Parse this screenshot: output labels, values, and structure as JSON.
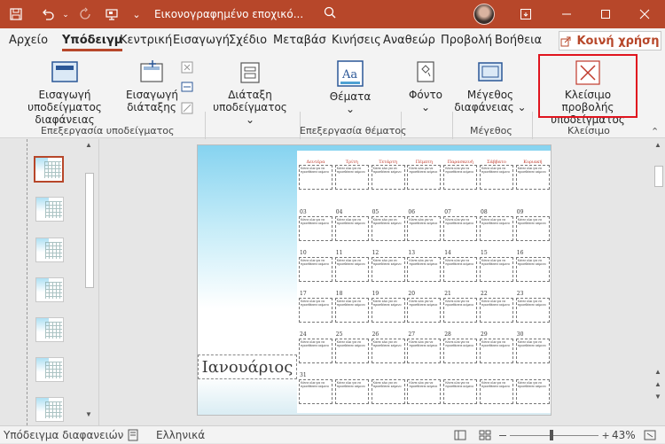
{
  "titlebar": {
    "title": "Εικονογραφημένο εποχικό...",
    "icons": [
      "save-icon",
      "undo-icon",
      "redo-icon",
      "present-icon",
      "more-icon",
      "search-icon"
    ]
  },
  "tabs": [
    "Αρχείο",
    "Υπόδειγμ",
    "Κεντρική",
    "Εισαγωγή",
    "Σχέδιο",
    "Μεταβάσ",
    "Κινήσεις",
    "Αναθεώρ",
    "Προβολή",
    "Βοήθεια"
  ],
  "share": {
    "label": "Κοινή χρήση"
  },
  "ribbon": {
    "insert_slide_master": "Εισαγωγή υποδείγματος διαφάνειας",
    "insert_layout": "Εισαγωγή διάταξης",
    "master_layout": "Διάταξη υποδείγματος",
    "themes": "Θέματα",
    "fonts": "Φόντο",
    "slide_size": "Μέγεθος διαφάνειας",
    "close_master": "Κλείσιμο προβολής υποδείγματος",
    "groups": {
      "edit_master": "Επεξεργασία υποδείγματος",
      "edit_theme": "Επεξεργασία θέματος",
      "size": "Μέγεθος",
      "close": "Κλείσιμο"
    }
  },
  "slide": {
    "days": [
      "Δευτέρα",
      "Τρίτη",
      "Τετάρτη",
      "Πέμπτη",
      "Παρασκευή",
      "Σάββατο",
      "Κυριακή"
    ],
    "rows": [
      [
        "",
        "",
        "",
        "",
        "",
        "",
        ""
      ],
      [
        "03",
        "04",
        "05",
        "06",
        "07",
        "08",
        "09"
      ],
      [
        "10",
        "11",
        "12",
        "13",
        "14",
        "15",
        "16"
      ],
      [
        "17",
        "18",
        "19",
        "20",
        "21",
        "22",
        "23"
      ],
      [
        "24",
        "25",
        "26",
        "27",
        "28",
        "29",
        "30"
      ],
      [
        "31",
        "",
        "",
        "",
        "",
        "",
        ""
      ]
    ],
    "placeholder": "Κάντε κλικ για να προσθέσετε κείμενο",
    "month": "Ιανουάριος"
  },
  "status": {
    "view": "Υπόδειγμα διαφανειών",
    "language": "Ελληνικά",
    "zoom": "43%"
  }
}
